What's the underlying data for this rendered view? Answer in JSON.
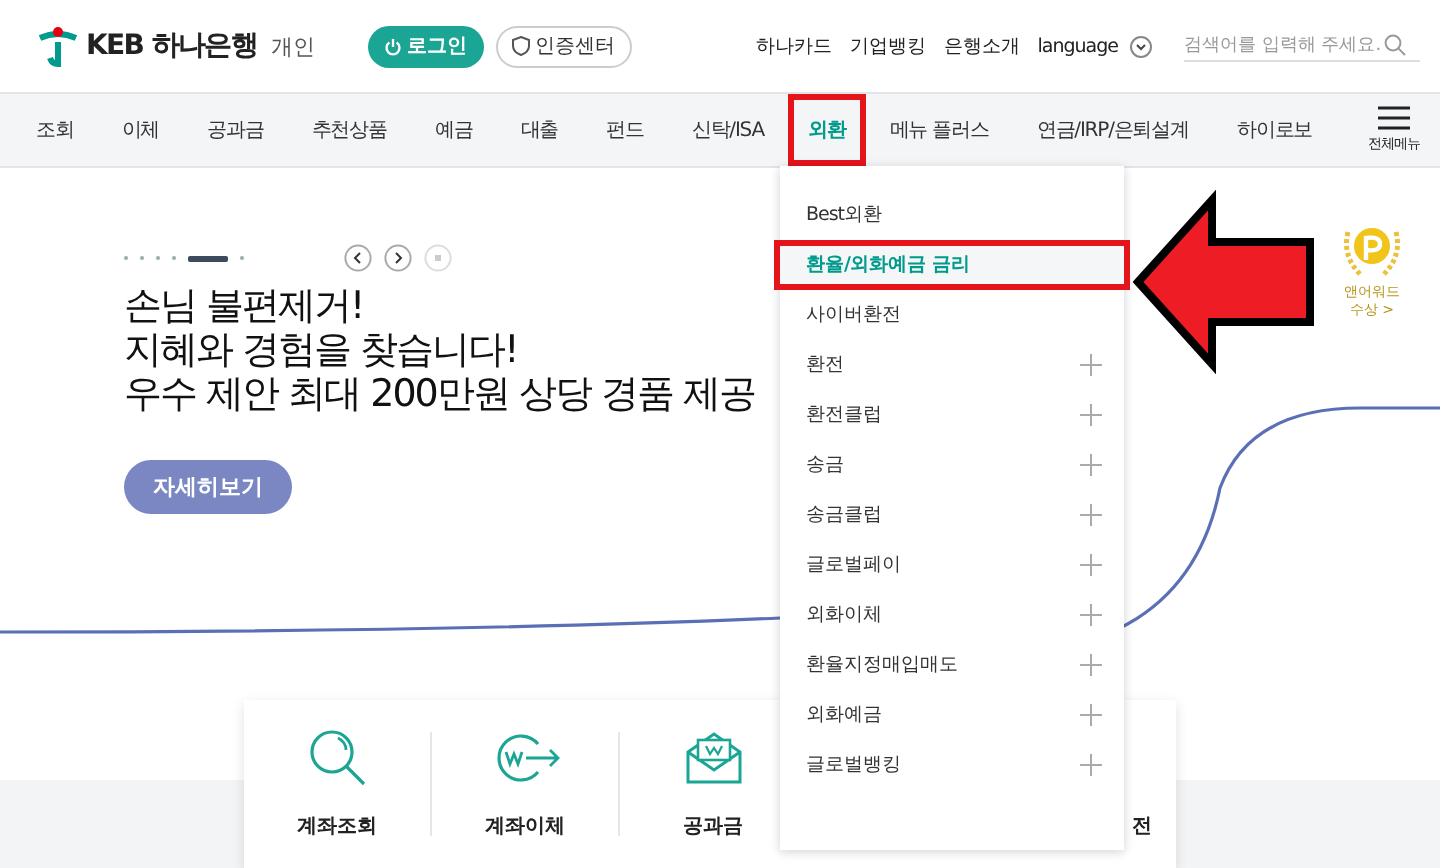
{
  "header": {
    "logo": "KEB 하나은행",
    "segment": "개인",
    "login_button": "로그인",
    "cert_button": "인증센터",
    "links": [
      "하나카드",
      "기업뱅킹",
      "은행소개",
      "language"
    ],
    "search": {
      "placeholder": "검색어를 입력해 주세요."
    }
  },
  "nav": {
    "items": [
      {
        "label": "조회",
        "selected": false
      },
      {
        "label": "이체",
        "selected": false
      },
      {
        "label": "공과금",
        "selected": false
      },
      {
        "label": "추천상품",
        "selected": false
      },
      {
        "label": "예금",
        "selected": false
      },
      {
        "label": "대출",
        "selected": false
      },
      {
        "label": "펀드",
        "selected": false
      },
      {
        "label": "신탁/ISA",
        "selected": false
      },
      {
        "label": "외환",
        "selected": true
      },
      {
        "label": "메뉴 플러스",
        "selected": false
      },
      {
        "label": "연금/IRP/은퇴설계",
        "selected": false
      },
      {
        "label": "하이로보",
        "selected": false
      }
    ],
    "all_menu": "전체메뉴"
  },
  "hero": {
    "slides": [
      {
        "selected": false
      },
      {
        "selected": false
      },
      {
        "selected": false
      },
      {
        "selected": false
      },
      {
        "selected": true
      },
      {
        "selected": false
      }
    ],
    "lines": [
      "손님 불편제거!",
      "지혜와 경험을 찾습니다!",
      "우수 제안 최대 200만원 상당 경품 제공"
    ],
    "button": "자세히보기"
  },
  "award": {
    "lines": [
      "앤어워드",
      "수상 >"
    ]
  },
  "dropdown": {
    "items": [
      {
        "label": "Best외환",
        "expandable": false,
        "selected": false
      },
      {
        "label": "환율/외화예금 금리",
        "expandable": false,
        "selected": true
      },
      {
        "label": "사이버환전",
        "expandable": false,
        "selected": false
      },
      {
        "label": "환전",
        "expandable": true,
        "selected": false
      },
      {
        "label": "환전클럽",
        "expandable": true,
        "selected": false
      },
      {
        "label": "송금",
        "expandable": true,
        "selected": false
      },
      {
        "label": "송금클럽",
        "expandable": true,
        "selected": false
      },
      {
        "label": "글로벌페이",
        "expandable": true,
        "selected": false
      },
      {
        "label": "외화이체",
        "expandable": true,
        "selected": false
      },
      {
        "label": "환율지정매입매도",
        "expandable": true,
        "selected": false
      },
      {
        "label": "외화예금",
        "expandable": true,
        "selected": false
      },
      {
        "label": "글로벌뱅킹",
        "expandable": true,
        "selected": false
      }
    ]
  },
  "quick_menu": [
    {
      "label": "계좌조회",
      "kind": "search"
    },
    {
      "label": "계좌이체",
      "kind": "transfer"
    },
    {
      "label": "공과금",
      "kind": "bill"
    },
    {
      "label": "전",
      "kind": "none"
    }
  ]
}
